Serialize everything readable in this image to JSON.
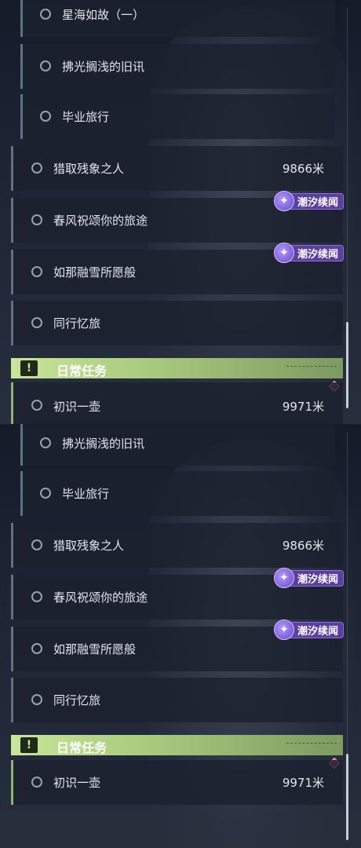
{
  "tasks": {
    "star_sea": "星海如故（一）",
    "brush_light": "拂光搁浅的旧讯",
    "grad_trip": "毕业旅行",
    "hunt": "猎取残象之人",
    "hunt_dist": "9866米",
    "spring": "春风祝颂你的旅途",
    "snow": "如那融雪所愿般",
    "together": "同行忆旅"
  },
  "badge_label": "潮汐续闻",
  "daily_header": "日常任务",
  "daily": {
    "first_pot": "初识一壶",
    "first_pot_dist": "9971米"
  },
  "icons": {
    "status": "circle-outline-icon",
    "badge": "tide-sparkle-icon",
    "header": "exclamation-icon",
    "marker": "red-diamond-icon"
  },
  "colors": {
    "accent_green": "#a9cc7e",
    "badge_purple": "#5a3fa0",
    "marker_red": "#d0344a"
  }
}
